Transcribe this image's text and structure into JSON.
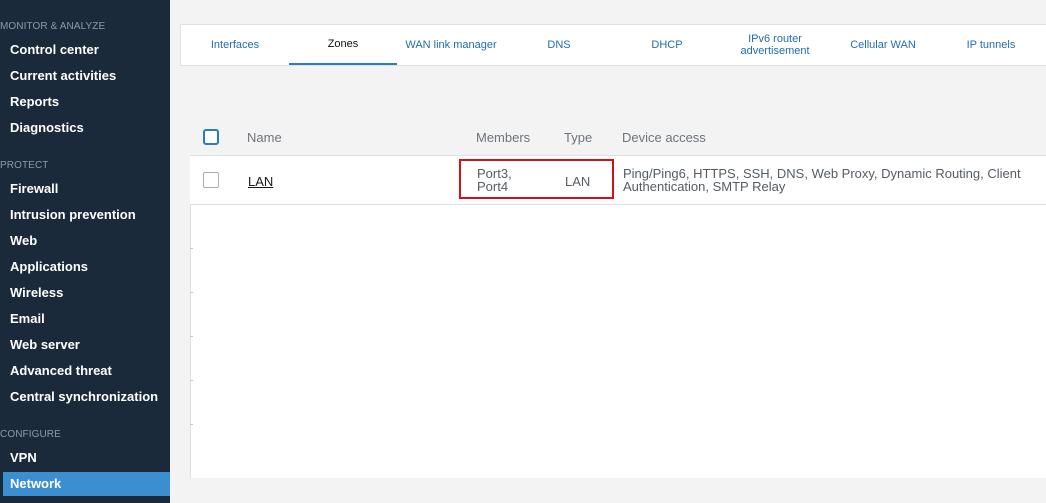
{
  "sidebar": {
    "sections": [
      {
        "title": "MONITOR & ANALYZE",
        "items": [
          "Control center",
          "Current activities",
          "Reports",
          "Diagnostics"
        ]
      },
      {
        "title": "PROTECT",
        "items": [
          "Firewall",
          "Intrusion prevention",
          "Web",
          "Applications",
          "Wireless",
          "Email",
          "Web server",
          "Advanced threat",
          "Central synchronization"
        ]
      },
      {
        "title": "CONFIGURE",
        "items": [
          "VPN",
          "Network"
        ]
      }
    ],
    "active_item": "Network"
  },
  "tabs": [
    {
      "label": "Interfaces",
      "active": false
    },
    {
      "label": "Zones",
      "active": true
    },
    {
      "label": "WAN link manager",
      "active": false
    },
    {
      "label": "DNS",
      "active": false
    },
    {
      "label": "DHCP",
      "active": false
    },
    {
      "label": "IPv6 router advertisement",
      "active": false
    },
    {
      "label": "Cellular WAN",
      "active": false
    },
    {
      "label": "IP tunnels",
      "active": false
    }
  ],
  "table": {
    "headers": {
      "name": "Name",
      "members": "Members",
      "type": "Type",
      "device_access": "Device access"
    },
    "rows": [
      {
        "name": "LAN",
        "members_line1": "Port3,",
        "members_line2": "Port4",
        "type": "LAN",
        "device_access": "Ping/Ping6, HTTPS, SSH, DNS, Web Proxy, Dynamic Routing, Client Authentication, SMTP Relay"
      }
    ]
  },
  "colors": {
    "sidebar_bg": "#1b2a3a",
    "active_nav": "#3b8fd1",
    "tab_link": "#1f6db3",
    "highlight": "#d0121a"
  }
}
